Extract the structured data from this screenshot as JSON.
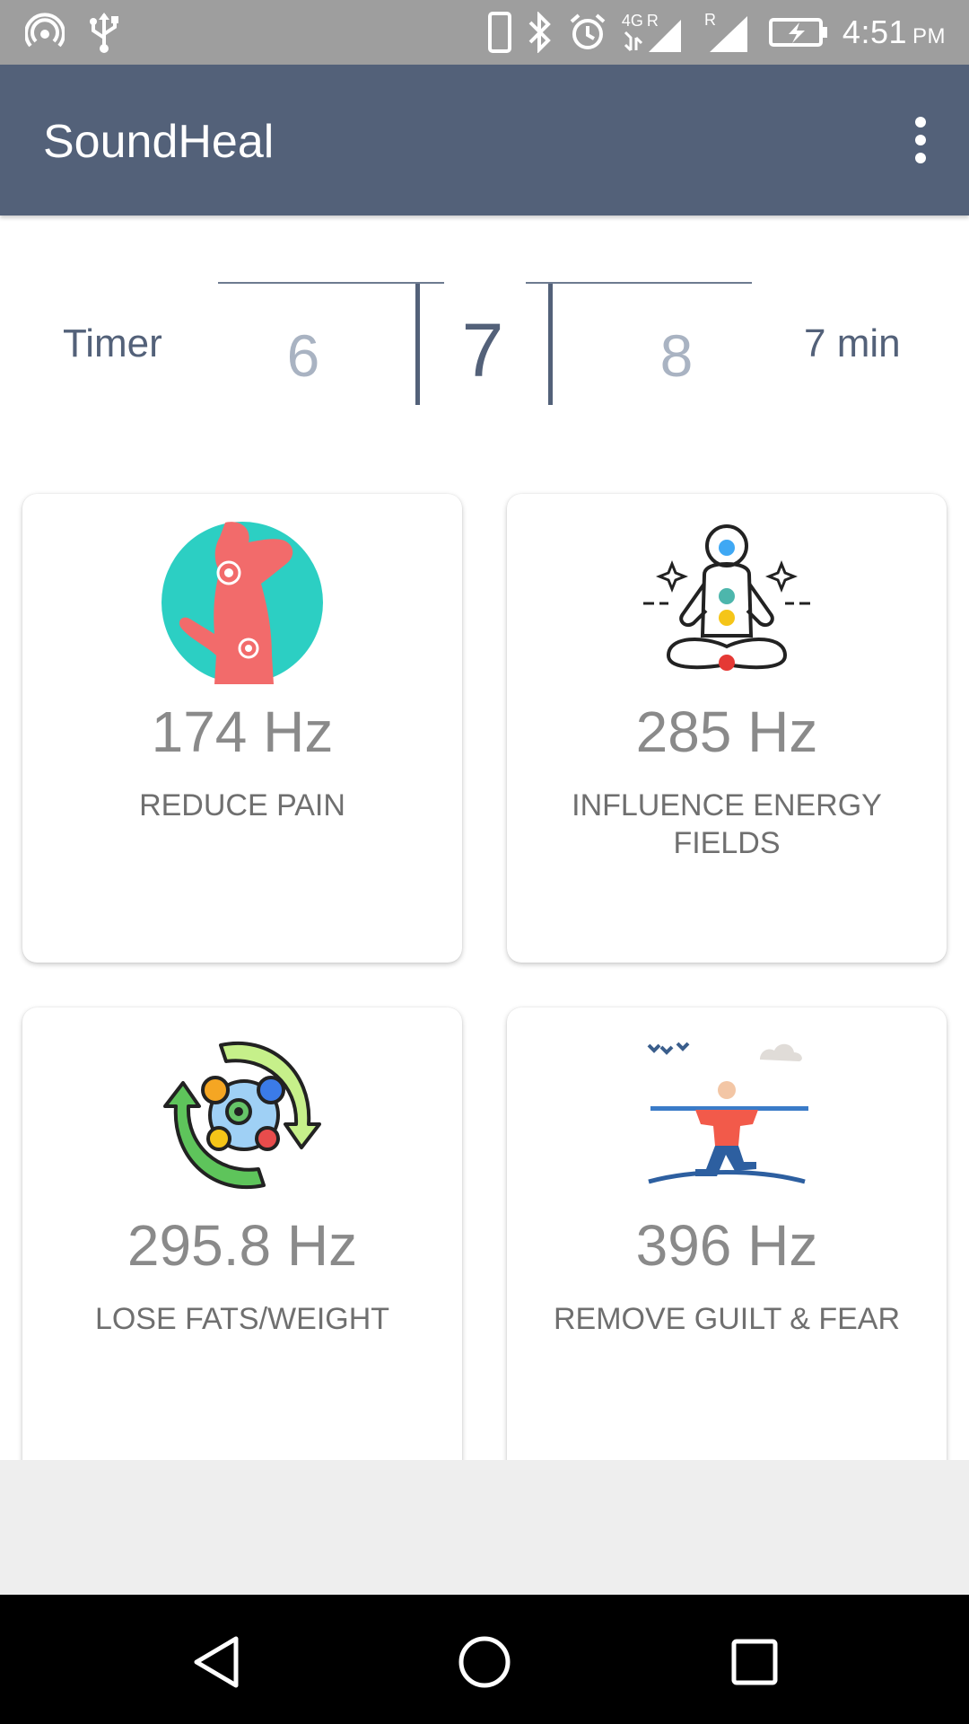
{
  "status_bar": {
    "time": "4:51",
    "ampm": "PM",
    "network": "4G",
    "sim1_label": "R",
    "icons": [
      "hotspot-icon",
      "usb-icon",
      "phone-icon",
      "bluetooth-icon",
      "alarm-icon",
      "signal-icon",
      "battery-charging-icon"
    ]
  },
  "app_bar": {
    "title": "SoundHeal",
    "menu_icon": "more-vert-icon"
  },
  "timer": {
    "label": "Timer",
    "picker_prev": "6",
    "picker_current": "7",
    "picker_next": "8",
    "value_text": "7 min"
  },
  "cards": [
    {
      "freq": "174 Hz",
      "desc": "REDUCE PAIN",
      "icon": "back-pain-icon"
    },
    {
      "freq": "285 Hz",
      "desc": "INFLUENCE ENERGY FIELDS",
      "icon": "meditation-chakra-icon"
    },
    {
      "freq": "295.8 Hz",
      "desc": "LOSE FATS/WEIGHT",
      "icon": "metabolism-cycle-icon"
    },
    {
      "freq": "396 Hz",
      "desc": "REMOVE GUILT & FEAR",
      "icon": "balance-walker-icon"
    }
  ],
  "nav_bar": {
    "icons": [
      "back-icon",
      "home-icon",
      "recents-icon"
    ]
  }
}
